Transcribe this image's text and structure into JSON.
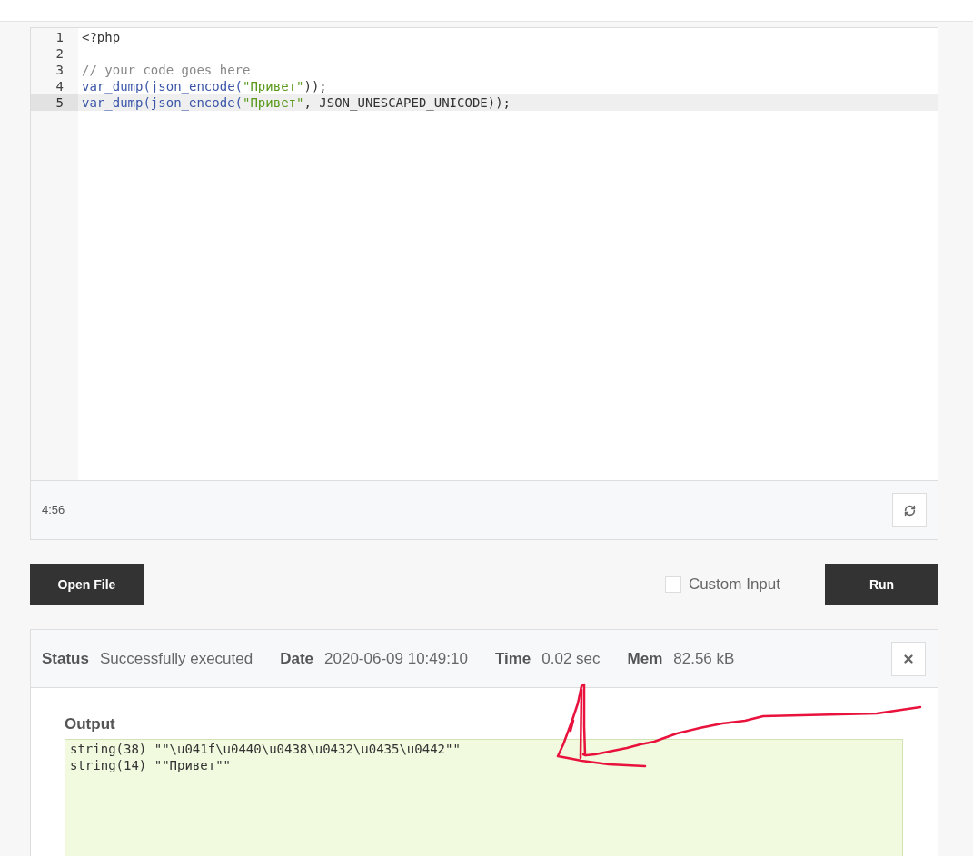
{
  "editor": {
    "lines": [
      {
        "number": "1",
        "active": false,
        "tokens": [
          {
            "text": "<?php",
            "kind": "plain"
          }
        ]
      },
      {
        "number": "2",
        "active": false
      },
      {
        "number": "3",
        "active": false,
        "tokens": [
          {
            "text": "// your code goes here",
            "kind": "comment"
          }
        ]
      },
      {
        "number": "4",
        "active": false,
        "tokens": [
          {
            "text": "var_dump(json_encode(",
            "kind": "func"
          },
          {
            "text": "\"Привет\"",
            "kind": "string"
          },
          {
            "text": "));",
            "kind": "plain"
          }
        ]
      },
      {
        "number": "5",
        "active": true,
        "tokens": [
          {
            "text": "var_dump(json_encode(",
            "kind": "func"
          },
          {
            "text": "\"Привет\"",
            "kind": "string"
          },
          {
            "text": ", JSON_UNESCAPED_UNICODE));",
            "kind": "plain"
          }
        ]
      }
    ],
    "cursor_position": "4:56"
  },
  "actions": {
    "open_file": "Open File",
    "custom_input": {
      "label": "Custom Input",
      "checked": false
    },
    "run": "Run"
  },
  "result": {
    "fields": [
      {
        "label": "Status",
        "value": "Successfully executed"
      },
      {
        "label": "Date",
        "value": "2020-06-09 10:49:10"
      },
      {
        "label": "Time",
        "value": "0.02 sec"
      },
      {
        "label": "Mem",
        "value": "82.56 kB"
      }
    ],
    "output_label": "Output",
    "output_lines": [
      "string(38) \"\"\\u041f\\u0440\\u0438\\u0432\\u0435\\u0442\"\"",
      "string(14) \"\"Привет\"\""
    ]
  },
  "annotations": [
    {
      "kind": "freehand-arrow"
    }
  ]
}
